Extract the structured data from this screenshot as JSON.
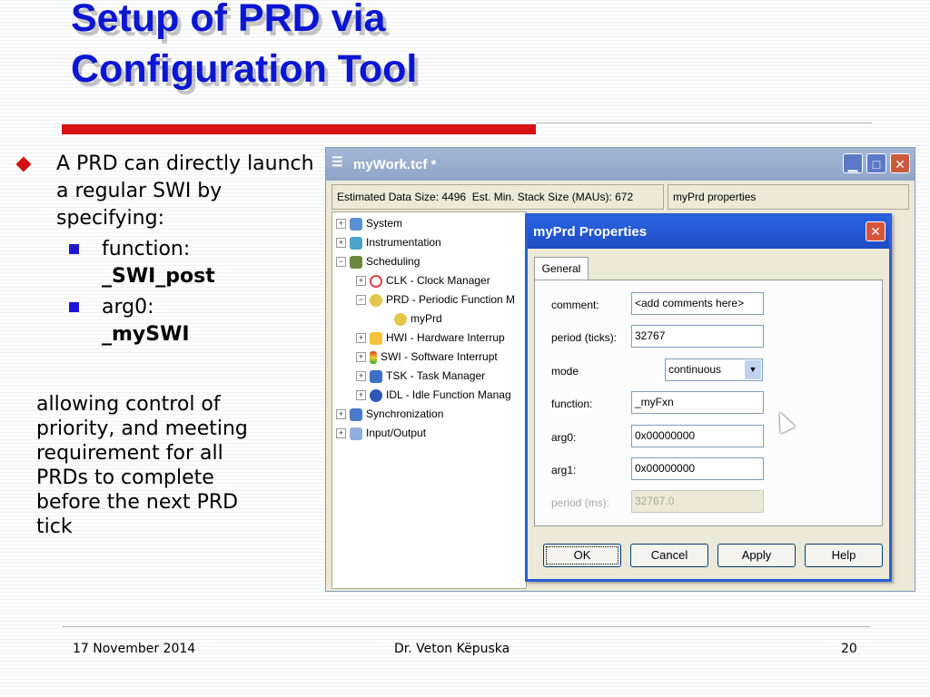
{
  "slide": {
    "title_line1": "Setup of PRD via",
    "title_line2": "Configuration Tool",
    "bullet_main": "A PRD can directly launch a regular SWI by specifying:",
    "sub1_label": "function:",
    "sub1_value": "_SWI_post",
    "sub2_label": "arg0:",
    "sub2_value": "_mySWI",
    "para_lines": [
      "allowing control of",
      "priority, and meeting",
      "requirement for all",
      "PRDs to complete",
      "before the next PRD",
      "tick"
    ]
  },
  "footer": {
    "date": "17 November 2014",
    "author": "Dr. Veton Këpuska",
    "page": "20"
  },
  "screenshot": {
    "window_title": "myWork.tcf *",
    "status_data_size": "Estimated Data Size: 4496",
    "status_stack_size": "Est. Min. Stack Size (MAUs): 672",
    "status_props": "myPrd properties",
    "tree": [
      {
        "label": "System",
        "icon": "system-icon"
      },
      {
        "label": "Instrumentation",
        "icon": "instrumentation-icon"
      },
      {
        "label": "Scheduling",
        "icon": "scheduling-icon"
      },
      {
        "label": "CLK - Clock Manager",
        "icon": "clock-icon"
      },
      {
        "label": "PRD - Periodic Function M",
        "icon": "prd-icon"
      },
      {
        "label": "myPrd",
        "icon": "prd-icon"
      },
      {
        "label": "HWI - Hardware Interrup",
        "icon": "hand-icon"
      },
      {
        "label": "SWI - Software Interrupt",
        "icon": "traffic-light-icon"
      },
      {
        "label": "TSK - Task Manager",
        "icon": "task-icon"
      },
      {
        "label": "IDL - Idle Function Manag",
        "icon": "idle-icon"
      },
      {
        "label": "Synchronization",
        "icon": "sync-icon"
      },
      {
        "label": "Input/Output",
        "icon": "io-icon"
      }
    ],
    "dialog": {
      "title": "myPrd Properties",
      "tab": "General",
      "comment_label": "comment:",
      "comment_value": "<add comments here>",
      "period_label": "period (ticks):",
      "period_value": "32767",
      "mode_label": "mode",
      "mode_value": "continuous",
      "function_label": "function:",
      "function_value": "_myFxn",
      "arg0_label": "arg0:",
      "arg0_value": "0x00000000",
      "arg1_label": "arg1:",
      "arg1_value": "0x00000000",
      "period_ms_label": "period (ms):",
      "period_ms_value": "32767.0",
      "ok": "OK",
      "cancel": "Cancel",
      "apply": "Apply",
      "help": "Help"
    }
  },
  "colors": {
    "title": "#0a16d2",
    "accent_red": "#d91111",
    "sub_bullet": "#1f15d6",
    "dialog_title": "#2a63e0"
  }
}
